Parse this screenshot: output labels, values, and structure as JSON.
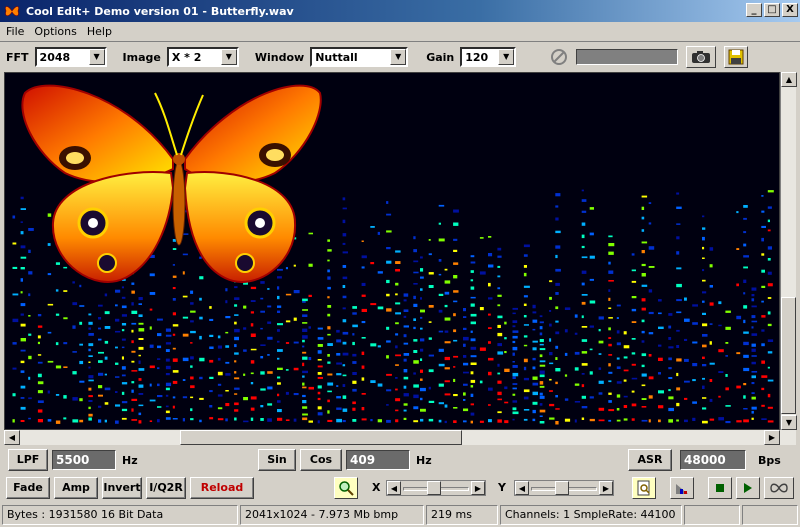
{
  "window": {
    "title": "Cool Edit+  Demo version 01 - Butterfly.wav",
    "min_label": "_",
    "max_label": "□",
    "close_label": "X"
  },
  "menu": [
    {
      "label": "File"
    },
    {
      "label": "Options"
    },
    {
      "label": "Help"
    }
  ],
  "toolbar": {
    "fft_label": "FFT",
    "fft_value": "2048",
    "image_label": "Image",
    "image_value": "X * 2",
    "window_label": "Window",
    "window_value": "Nuttall",
    "gain_label": "Gain",
    "gain_value": "120"
  },
  "controls": {
    "lpf_label": "LPF",
    "lpf_value": "5500",
    "lpf_unit": "Hz",
    "sin_label": "Sin",
    "cos_label": "Cos",
    "freq_value": "409",
    "freq_unit": "Hz",
    "asr_label": "ASR",
    "asr_value": "48000",
    "asr_unit": "Bps",
    "fade_label": "Fade",
    "amp_label": "Amp",
    "invert_label": "Invert",
    "iq_label": "I/Q2R",
    "reload_label": "Reload",
    "x_label": "X",
    "y_label": "Y"
  },
  "status": {
    "bytes": "Bytes : 1931580 16 Bit Data",
    "bitmap": "2041x1024 - 7.973 Mb bmp",
    "duration": "219 ms",
    "channels": "Channels: 1  SmpleRate: 44100"
  },
  "colors": {
    "reload_text": "#c00000",
    "spectrogram_bg": "#000010"
  },
  "icons": {
    "app": "butterfly-icon",
    "disabled": "no-entry-icon",
    "camera": "camera-icon",
    "save": "floppy-disk-icon",
    "zoom": "magnifier-icon",
    "page": "page-zoom-icon",
    "chart": "chart-icon",
    "stop": "stop-icon",
    "play": "play-icon",
    "loop": "loop-icon"
  }
}
